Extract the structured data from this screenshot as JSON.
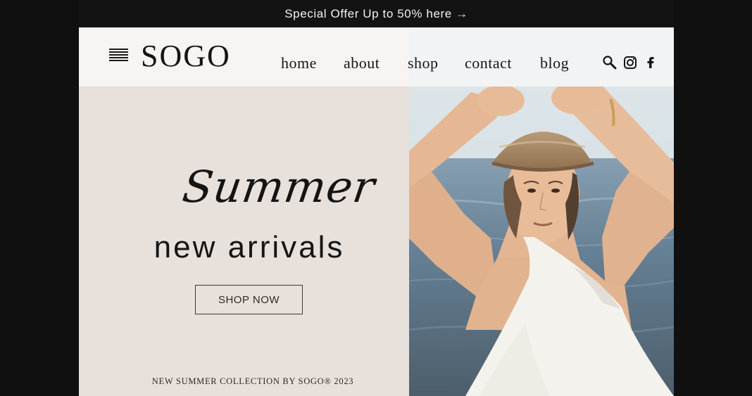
{
  "promo": {
    "text": "Special Offer Up to 50% here →"
  },
  "header": {
    "logo": "SOGO",
    "nav": [
      {
        "label": "home"
      },
      {
        "label": "about"
      },
      {
        "label": "shop"
      },
      {
        "label": "contact"
      },
      {
        "label": "blog"
      }
    ],
    "icons": [
      "menu-icon",
      "search-icon",
      "instagram-icon",
      "facebook-icon"
    ]
  },
  "hero": {
    "script_title": "Summer",
    "title": "new arrivals",
    "button_label": "SHOP NOW",
    "collection_text": "NEW SUMMER COLLECTION BY SOGO® 2023"
  },
  "colors": {
    "panel": "#e8e0db",
    "dark": "#131313",
    "text": "#151515"
  }
}
